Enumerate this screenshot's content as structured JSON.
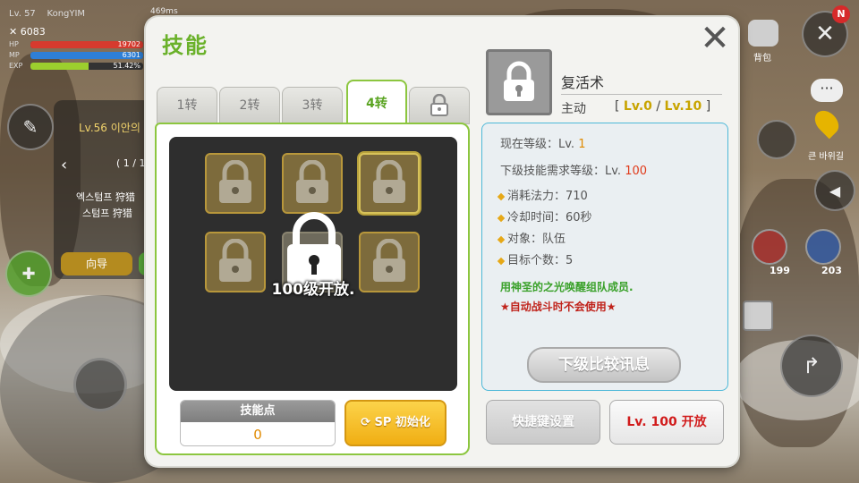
{
  "hud": {
    "level": "Lv. 57",
    "player_name": "KongYIM",
    "power": "6083",
    "hp_label": "HP",
    "hp_value": "19702",
    "mp_label": "MP",
    "mp_value": "6301",
    "exp_label": "EXP",
    "exp_value": "51.42%",
    "ping": "469ms",
    "notification_badge": "N",
    "bag_label": "背包",
    "map_label": "큰 바위길"
  },
  "quest": {
    "level": "Lv.56 이안의",
    "page": "( 1 / 1",
    "line1": "엑스텀프 狩猎",
    "line2": "스텀프 狩猎",
    "guide_button": "向导"
  },
  "potions": {
    "hp_count": "199",
    "mp_count": "203"
  },
  "dialog": {
    "title": "技能",
    "tabs": [
      {
        "label": "1转",
        "active": false
      },
      {
        "label": "2转",
        "active": false
      },
      {
        "label": "3转",
        "active": false
      },
      {
        "label": "4转",
        "active": true
      }
    ],
    "grid_lock_text": "100级开放.",
    "skill_points_label": "技能点",
    "skill_points_value": "0",
    "sp_reset_label": "SP 初始化",
    "skill": {
      "name": "复活术",
      "type": "主动",
      "level_prefix": "[",
      "level_current": "Lv.0",
      "level_sep": "/",
      "level_max": "Lv.10",
      "level_suffix": "]"
    },
    "info": {
      "current_level_label": "现在等级：Lv.",
      "current_level_value": "1",
      "next_required_label": "下级技能需求等级：Lv.",
      "next_required_value": "100",
      "mp_cost": "消耗法力：710",
      "cooldown": "冷却时间：60秒",
      "target": "对象：队伍",
      "target_count": "目标个数：5",
      "description": "用神圣的之光唤醒组队成员.",
      "warning": "★自动战斗时不会使用★",
      "compare_button": "下级比较讯息"
    },
    "shortcut_button": "快捷键设置",
    "unlock_button": "Lv. 100 开放"
  },
  "colors": {
    "accent_green": "#6ab12a",
    "hp_bar": "#d63a2e",
    "mp_bar": "#2e7fd6",
    "exp_bar": "#9ccf2e",
    "reset_gold": "#f0ae13",
    "info_border": "#4db8d8"
  },
  "bars": {
    "hp_fill": 1.0,
    "mp_fill": 1.0,
    "exp_fill": 0.5142
  }
}
